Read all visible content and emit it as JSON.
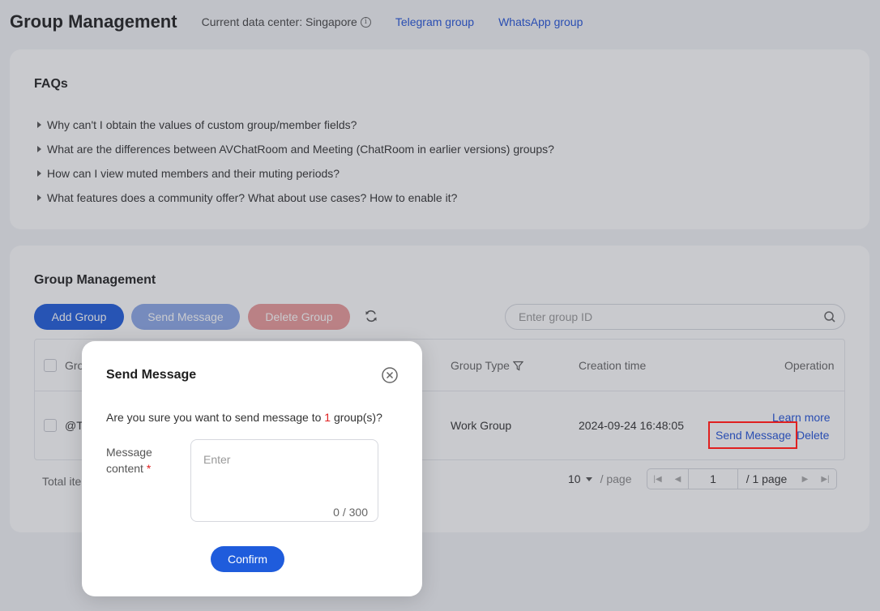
{
  "header": {
    "title": "Group Management",
    "data_center": "Current data center: Singapore",
    "info_glyph": "i",
    "links": [
      "Telegram group",
      "WhatsApp group"
    ]
  },
  "faq": {
    "title": "FAQs",
    "items": [
      "Why can't I obtain the values of custom group/member fields?",
      "What are the differences between AVChatRoom and Meeting (ChatRoom in earlier versions) groups?",
      "How can I view muted members and their muting periods?",
      "What features does a community offer? What about use cases? How to enable it?"
    ]
  },
  "group_management": {
    "title": "Group Management",
    "buttons": {
      "add": "Add Group",
      "send": "Send Message",
      "delete": "Delete Group"
    },
    "search_placeholder": "Enter group ID",
    "table": {
      "columns": {
        "group_id": "Gro",
        "group_type": "Group Type",
        "creation_time": "Creation time",
        "operation": "Operation"
      },
      "rows": [
        {
          "group_id": "@T(",
          "group_type": "Work Group",
          "creation_time": "2024-09-24 16:48:05",
          "ops": {
            "learn_more": "Learn more",
            "send_message": "Send Message",
            "delete": "Delete"
          }
        }
      ]
    },
    "footer": {
      "total": "Total ite",
      "page_size": "10",
      "per_page": "/ page",
      "current_page": "1",
      "total_pages": "/ 1 page"
    }
  },
  "modal": {
    "title": "Send Message",
    "question_prefix": "Are you sure you want to send message to ",
    "count": "1",
    "question_suffix": " group(s)?",
    "field_label": "Message content",
    "required_mark": "*",
    "placeholder": "Enter",
    "char_count": "0 / 300",
    "confirm": "Confirm"
  },
  "colors": {
    "primary": "#1f5cdc",
    "link": "#2253d8",
    "danger": "#e02020"
  }
}
